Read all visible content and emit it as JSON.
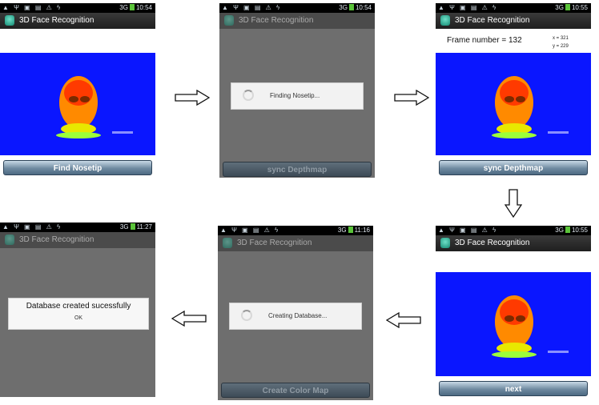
{
  "app_title": "3D Face Recognition",
  "screens": [
    {
      "time": "10:54",
      "button": "Find Nosetip"
    },
    {
      "time": "10:54",
      "dialog": "Finding Nosetip...",
      "button": "sync Depthmap"
    },
    {
      "time": "10:55",
      "frame_label": "Frame number = 132",
      "coord_x": "x = 321",
      "coord_y": "y = 229",
      "button": "sync Depthmap"
    },
    {
      "time": "10:55",
      "button": "next"
    },
    {
      "time": "11:16",
      "dialog": "Creating Database...",
      "button": "Create Color Map"
    },
    {
      "time": "11:27",
      "alert": "Database created sucessfully",
      "alert_ok": "OK"
    }
  ],
  "status_icons": "▲ Ψ ▣ ▤ ⚠ ϟ",
  "signal_text": "3G",
  "colors": {
    "depth_background": "#0a16ff",
    "button": "#5f7c95",
    "dim_overlay": "#6e6e6e"
  },
  "icons": [
    "right-arrow-icon",
    "down-arrow-icon",
    "left-arrow-icon",
    "spinner-icon",
    "app-icon"
  ]
}
